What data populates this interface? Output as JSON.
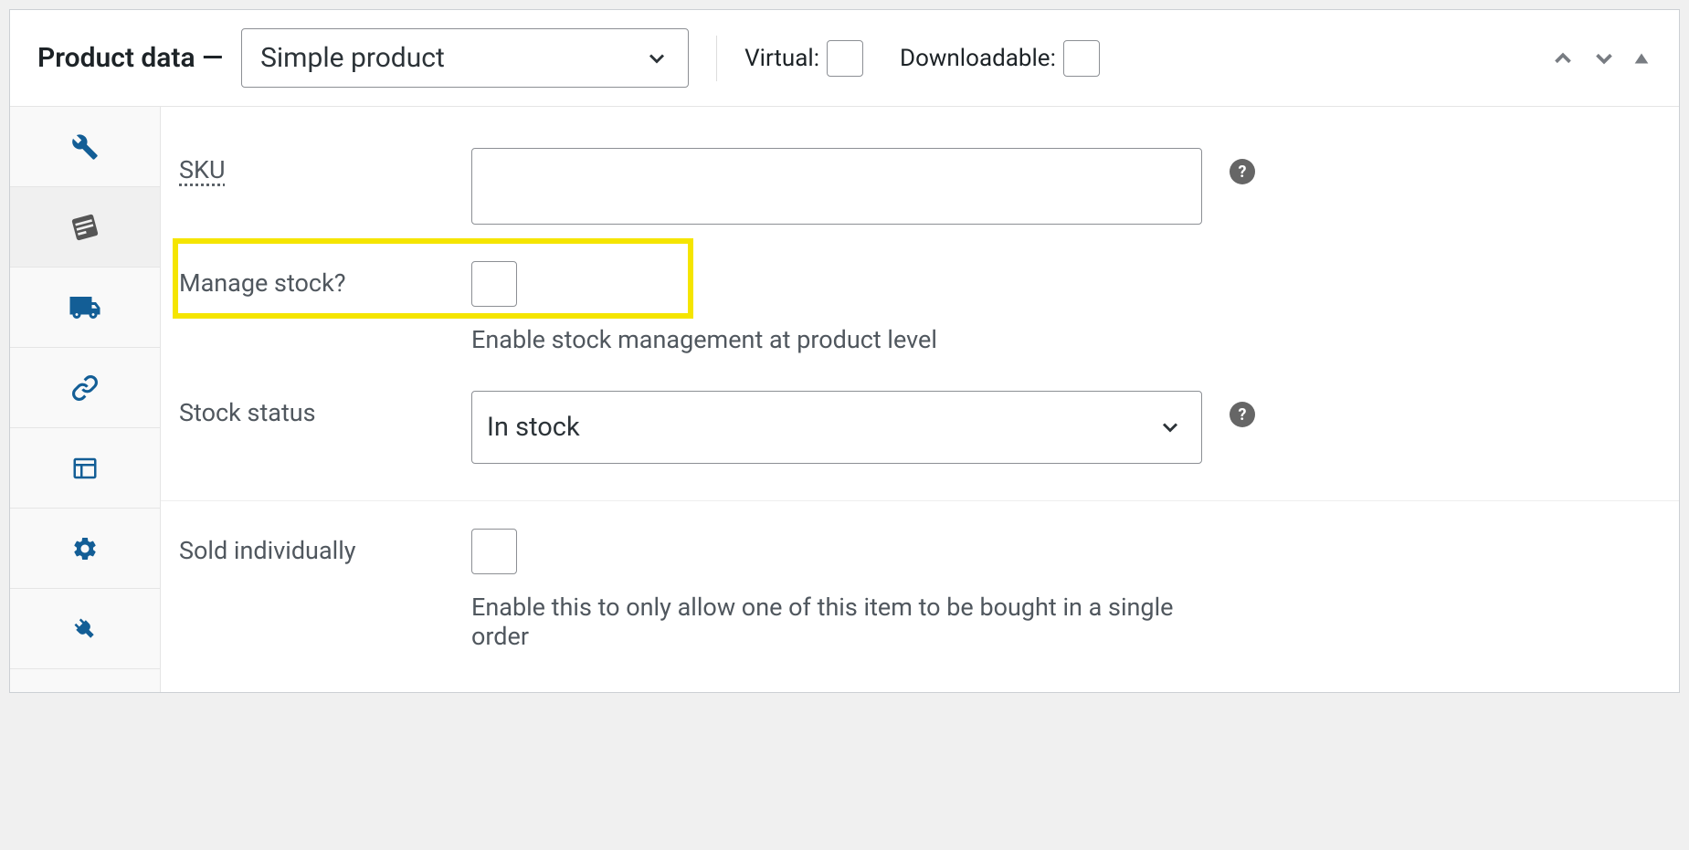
{
  "header": {
    "title": "Product data —",
    "product_type_selected": "Simple product",
    "virtual_label": "Virtual:",
    "downloadable_label": "Downloadable:"
  },
  "tabs": {
    "general_icon": "wrench-icon",
    "inventory_icon": "inventory-icon",
    "shipping_icon": "truck-icon",
    "linked_icon": "link-icon",
    "attributes_icon": "list-icon",
    "advanced_icon": "gear-icon",
    "get_more_icon": "plug-icon"
  },
  "inventory": {
    "sku_label": "SKU",
    "sku_value": "",
    "manage_stock_label": "Manage stock?",
    "manage_stock_help": "Enable stock management at product level",
    "stock_status_label": "Stock status",
    "stock_status_value": "In stock",
    "sold_individually_label": "Sold individually",
    "sold_individually_help": "Enable this to only allow one of this item to be bought in a single order"
  }
}
